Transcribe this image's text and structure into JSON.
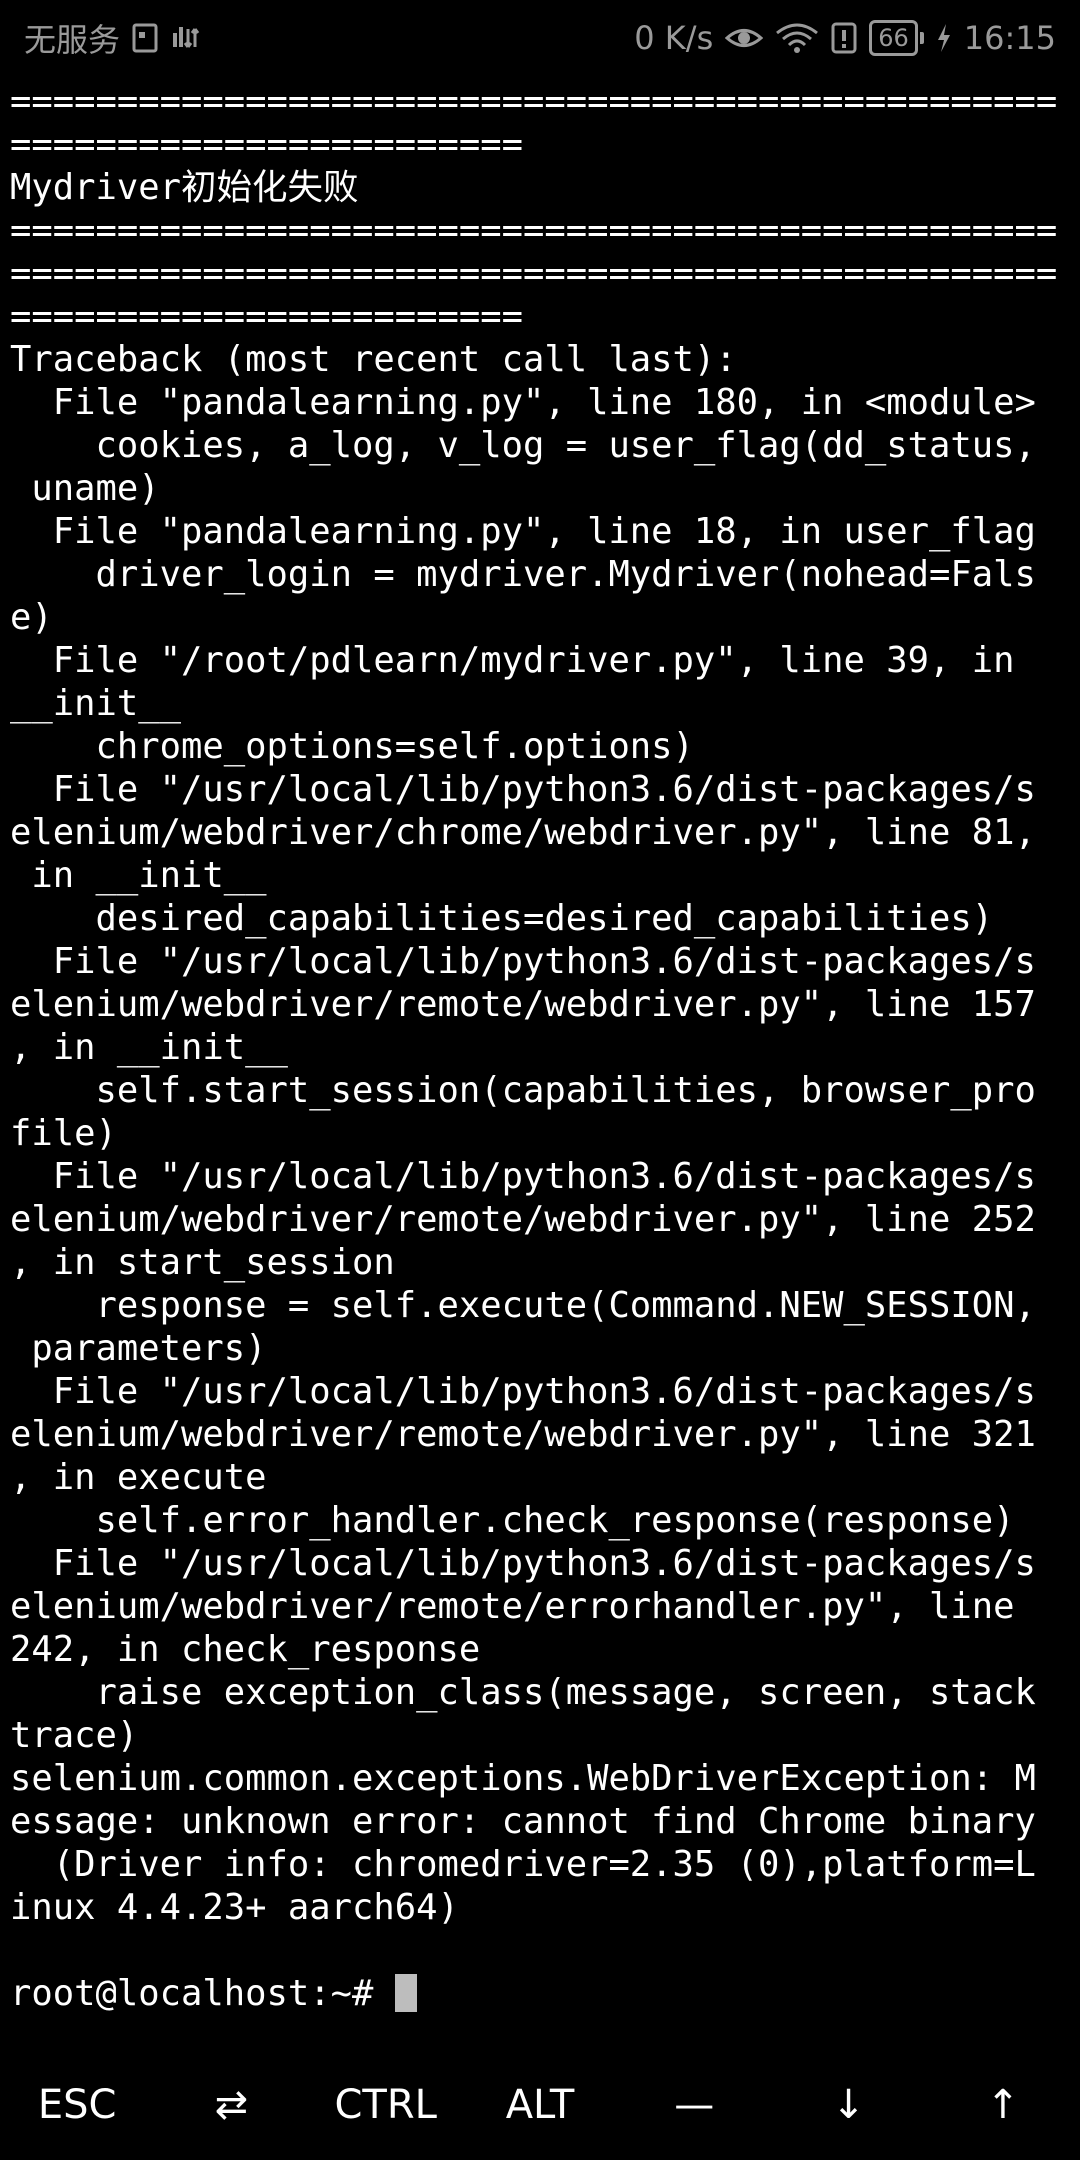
{
  "status_bar": {
    "carrier": "无服务",
    "network_speed": "0 K/s",
    "battery_level": "66",
    "time": "16:15"
  },
  "terminal": {
    "lines": [
      "=================================================",
      "========================",
      "Mydriver初始化失败",
      "=================================================",
      "=================================================",
      "========================",
      "Traceback (most recent call last):",
      "  File \"pandalearning.py\", line 180, in <module>",
      "    cookies, a_log, v_log = user_flag(dd_status,",
      " uname)",
      "  File \"pandalearning.py\", line 18, in user_flag",
      "    driver_login = mydriver.Mydriver(nohead=Fals",
      "e)",
      "  File \"/root/pdlearn/mydriver.py\", line 39, in",
      "__init__",
      "    chrome_options=self.options)",
      "  File \"/usr/local/lib/python3.6/dist-packages/s",
      "elenium/webdriver/chrome/webdriver.py\", line 81,",
      " in __init__",
      "    desired_capabilities=desired_capabilities)",
      "  File \"/usr/local/lib/python3.6/dist-packages/s",
      "elenium/webdriver/remote/webdriver.py\", line 157",
      ", in __init__",
      "    self.start_session(capabilities, browser_pro",
      "file)",
      "  File \"/usr/local/lib/python3.6/dist-packages/s",
      "elenium/webdriver/remote/webdriver.py\", line 252",
      ", in start_session",
      "    response = self.execute(Command.NEW_SESSION,",
      " parameters)",
      "  File \"/usr/local/lib/python3.6/dist-packages/s",
      "elenium/webdriver/remote/webdriver.py\", line 321",
      ", in execute",
      "    self.error_handler.check_response(response)",
      "  File \"/usr/local/lib/python3.6/dist-packages/s",
      "elenium/webdriver/remote/errorhandler.py\", line",
      "242, in check_response",
      "    raise exception_class(message, screen, stack",
      "trace)",
      "selenium.common.exceptions.WebDriverException: M",
      "essage: unknown error: cannot find Chrome binary",
      "  (Driver info: chromedriver=2.35 (0),platform=L",
      "inux 4.4.23+ aarch64)",
      "",
      "root@localhost:~# "
    ]
  },
  "extra_keys": [
    {
      "label": "ESC",
      "name": "esc-key"
    },
    {
      "label": "⇄",
      "name": "tab-key"
    },
    {
      "label": "CTRL",
      "name": "ctrl-key"
    },
    {
      "label": "ALT",
      "name": "alt-key"
    },
    {
      "label": "—",
      "name": "dash-key"
    },
    {
      "label": "↓",
      "name": "down-arrow-key"
    },
    {
      "label": "↑",
      "name": "up-arrow-key"
    }
  ]
}
